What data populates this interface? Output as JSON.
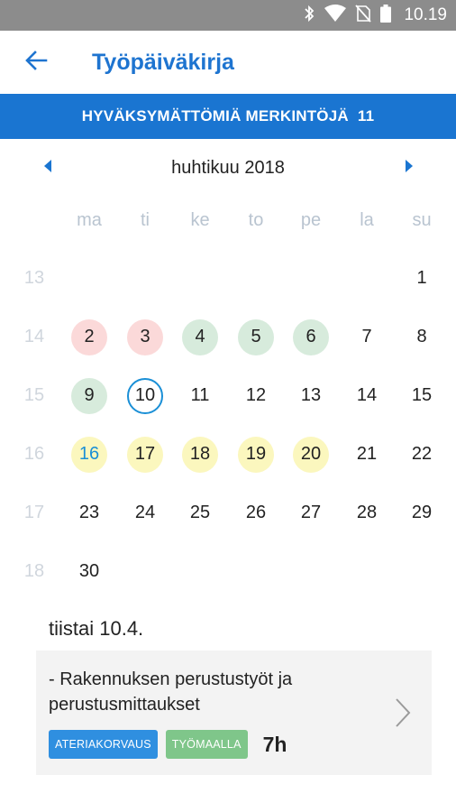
{
  "status_bar": {
    "time": "10.19",
    "icons": [
      "bluetooth-icon",
      "wifi-icon",
      "no-sim-icon",
      "battery-icon"
    ]
  },
  "app_bar": {
    "title": "Työpäiväkirja",
    "back_icon": "arrow-left-icon"
  },
  "banner": {
    "text": "HYVÄKSYMÄTTÖMIÄ MERKINTÖJÄ",
    "count": "11"
  },
  "calendar": {
    "month_label": "huhtikuu 2018",
    "weekdays": [
      "ma",
      "ti",
      "ke",
      "to",
      "pe",
      "la",
      "su"
    ],
    "weeks": [
      {
        "week": "13",
        "days": [
          {
            "d": "",
            "s": ""
          },
          {
            "d": "",
            "s": ""
          },
          {
            "d": "",
            "s": ""
          },
          {
            "d": "",
            "s": ""
          },
          {
            "d": "",
            "s": ""
          },
          {
            "d": "",
            "s": ""
          },
          {
            "d": "1",
            "s": ""
          }
        ]
      },
      {
        "week": "14",
        "days": [
          {
            "d": "2",
            "s": "red"
          },
          {
            "d": "3",
            "s": "red"
          },
          {
            "d": "4",
            "s": "green"
          },
          {
            "d": "5",
            "s": "green"
          },
          {
            "d": "6",
            "s": "green"
          },
          {
            "d": "7",
            "s": ""
          },
          {
            "d": "8",
            "s": ""
          }
        ]
      },
      {
        "week": "15",
        "days": [
          {
            "d": "9",
            "s": "green"
          },
          {
            "d": "10",
            "s": "today"
          },
          {
            "d": "11",
            "s": ""
          },
          {
            "d": "12",
            "s": ""
          },
          {
            "d": "13",
            "s": ""
          },
          {
            "d": "14",
            "s": ""
          },
          {
            "d": "15",
            "s": ""
          }
        ]
      },
      {
        "week": "16",
        "days": [
          {
            "d": "16",
            "s": "yellow-bluetext"
          },
          {
            "d": "17",
            "s": "yellow"
          },
          {
            "d": "18",
            "s": "yellow"
          },
          {
            "d": "19",
            "s": "yellow"
          },
          {
            "d": "20",
            "s": "yellow"
          },
          {
            "d": "21",
            "s": ""
          },
          {
            "d": "22",
            "s": ""
          }
        ]
      },
      {
        "week": "17",
        "days": [
          {
            "d": "23",
            "s": ""
          },
          {
            "d": "24",
            "s": ""
          },
          {
            "d": "25",
            "s": ""
          },
          {
            "d": "26",
            "s": ""
          },
          {
            "d": "27",
            "s": ""
          },
          {
            "d": "28",
            "s": ""
          },
          {
            "d": "29",
            "s": ""
          }
        ]
      },
      {
        "week": "18",
        "days": [
          {
            "d": "30",
            "s": ""
          },
          {
            "d": "",
            "s": ""
          },
          {
            "d": "",
            "s": ""
          },
          {
            "d": "",
            "s": ""
          },
          {
            "d": "",
            "s": ""
          },
          {
            "d": "",
            "s": ""
          },
          {
            "d": "",
            "s": ""
          }
        ]
      }
    ]
  },
  "selected_day": {
    "label": "tiistai 10.4.",
    "entry": {
      "title": "- Rakennuksen perustustyöt ja perustusmittaukset",
      "tags": [
        "ATERIAKORVAUS",
        "TYÖMAALLA"
      ],
      "hours": "7h"
    }
  },
  "colors": {
    "primary": "#1a75d1",
    "status_red": "#fbd9d9",
    "status_green": "#d7ebdc",
    "status_yellow": "#fbf7be",
    "today_ring": "#1a8fd6",
    "tag_blue": "#2f8fe0",
    "tag_green": "#7fc68a"
  }
}
